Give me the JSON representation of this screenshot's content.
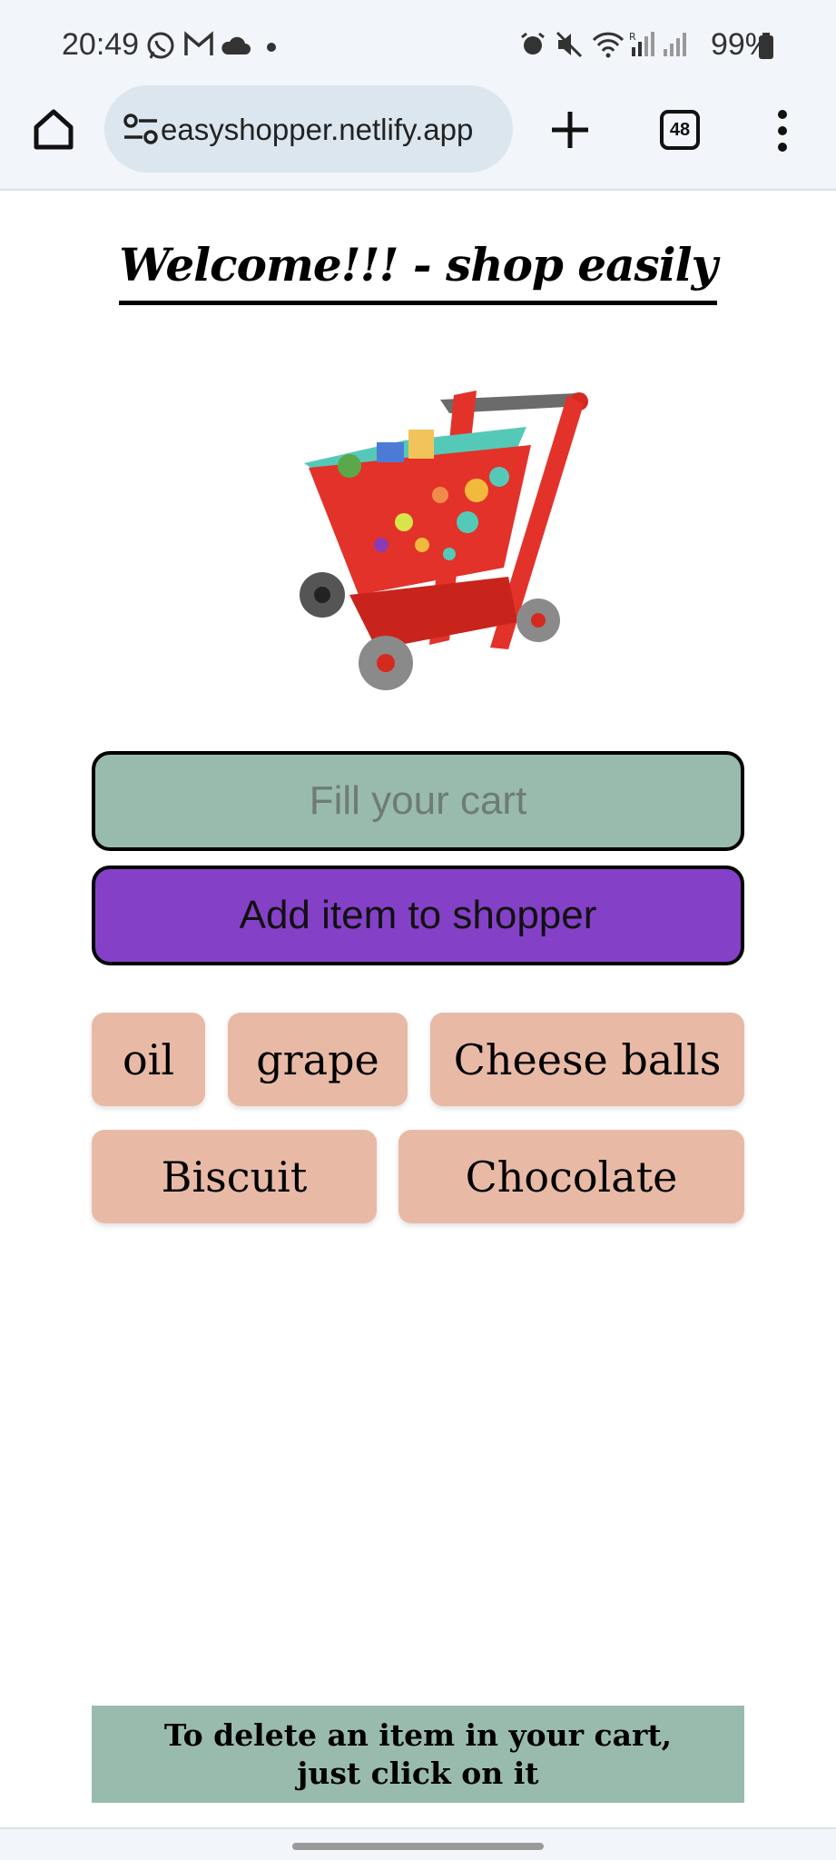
{
  "status_bar": {
    "time": "20:49",
    "battery": "99%",
    "icons": [
      "whatsapp-icon",
      "gmail-icon",
      "cloud-icon",
      "dot-icon",
      "alarm-icon",
      "mute-icon",
      "wifi-icon",
      "signal-r-icon",
      "signal-icon",
      "battery-icon"
    ]
  },
  "browser": {
    "url": "easyshopper.netlify.app",
    "tab_count": "48"
  },
  "page": {
    "title": "Welcome!!! - shop easily",
    "input_placeholder": "Fill your cart",
    "add_button_label": "Add item to shopper",
    "items": [
      "oil",
      "grape",
      "Cheese balls",
      "Biscuit",
      "Chocolate"
    ],
    "footer_note": "To delete an item in your cart, just click on it"
  },
  "colors": {
    "input_bg": "#99bbad",
    "add_button_bg": "#8540c8",
    "chip_bg": "#e8baa6",
    "footer_bg": "#99bbad"
  }
}
